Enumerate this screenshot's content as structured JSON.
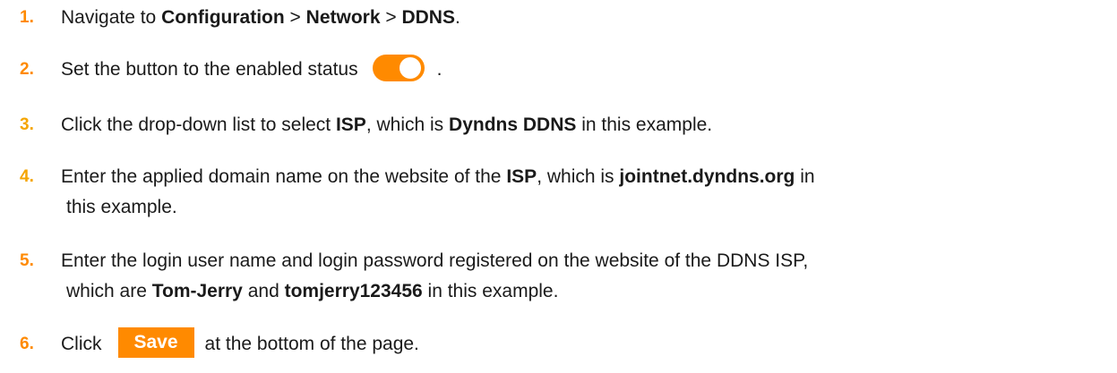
{
  "steps": [
    {
      "num": "1.",
      "parts": {
        "a": "Navigate to ",
        "b": "Configuration",
        "c": " > ",
        "d": "Network",
        "e": " > ",
        "f": "DDNS",
        "g": "."
      }
    },
    {
      "num": "2.",
      "parts": {
        "a": "Set the button to the enabled status",
        "b": "."
      },
      "toggle_state": "on"
    },
    {
      "num": "3.",
      "parts": {
        "a": "Click the drop-down list to select ",
        "b": "ISP",
        "c": ", which is ",
        "d": "Dyndns DDNS",
        "e": " in this example."
      }
    },
    {
      "num": "4.",
      "parts": {
        "a": "Enter the applied domain name on the website of the ",
        "b": "ISP",
        "c": ", which is ",
        "d": "jointnet.dyndns.org",
        "e": " in",
        "f": "this example."
      }
    },
    {
      "num": "5.",
      "parts": {
        "a": "Enter the login user name and login password registered on the website of the DDNS ISP,",
        "b": "which are ",
        "c": "Tom-Jerry",
        "d": " and ",
        "e": "tomjerry123456",
        "f": " in this example."
      }
    },
    {
      "num": "6.",
      "parts": {
        "a": "Click",
        "b": "Save",
        "c": "at the bottom of the page."
      }
    }
  ],
  "colors": {
    "accent": "#ff8a00",
    "text": "#1a1a1a"
  }
}
